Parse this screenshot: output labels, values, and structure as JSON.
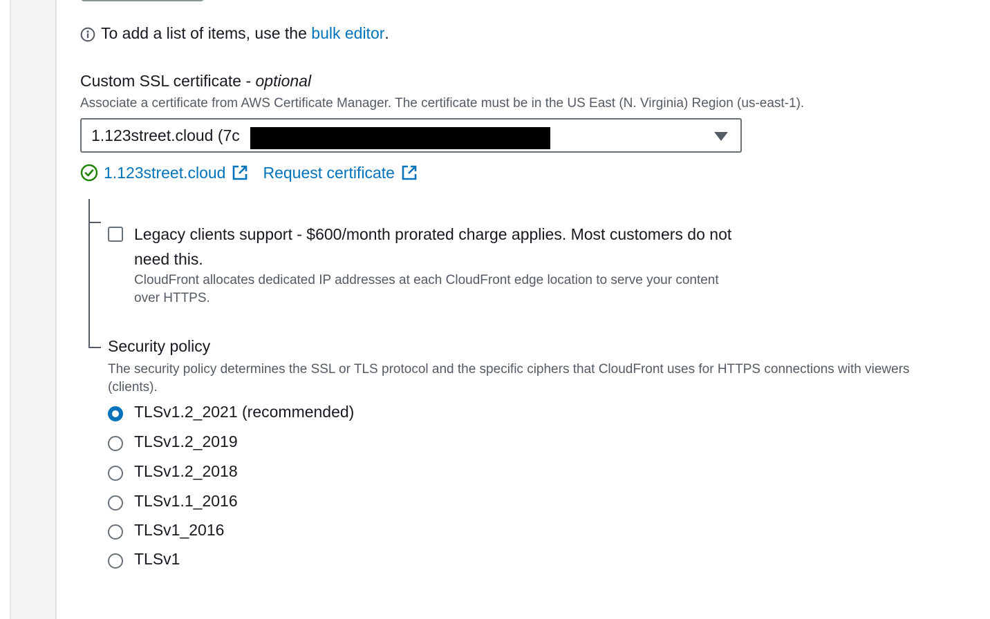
{
  "info": {
    "text_before": "To add a list of items, use the ",
    "link": "bulk editor",
    "text_after": "."
  },
  "ssl": {
    "label": "Custom SSL certificate - ",
    "label_optional": "optional",
    "description": "Associate a certificate from AWS Certificate Manager. The certificate must be in the US East (N. Virginia) Region (us-east-1).",
    "selected_value": "1.123street.cloud (7c",
    "cert_link": "1.123street.cloud",
    "request_link": "Request certificate"
  },
  "legacy": {
    "label": "Legacy clients support - $600/month prorated charge applies. Most customers do not need this.",
    "description": "CloudFront allocates dedicated IP addresses at each CloudFront edge location to serve your content over HTTPS.",
    "checked": false
  },
  "security_policy": {
    "label": "Security policy",
    "description": "The security policy determines the SSL or TLS protocol and the specific ciphers that CloudFront uses for HTTPS connections with viewers (clients).",
    "options": [
      {
        "label": "TLSv1.2_2021 (recommended)",
        "selected": true
      },
      {
        "label": "TLSv1.2_2019",
        "selected": false
      },
      {
        "label": "TLSv1.2_2018",
        "selected": false
      },
      {
        "label": "TLSv1.1_2016",
        "selected": false
      },
      {
        "label": "TLSv1_2016",
        "selected": false
      },
      {
        "label": "TLSv1",
        "selected": false
      }
    ]
  },
  "colors": {
    "link": "#0073bb",
    "success": "#1d8102",
    "text": "#16191f",
    "muted": "#545b64"
  }
}
